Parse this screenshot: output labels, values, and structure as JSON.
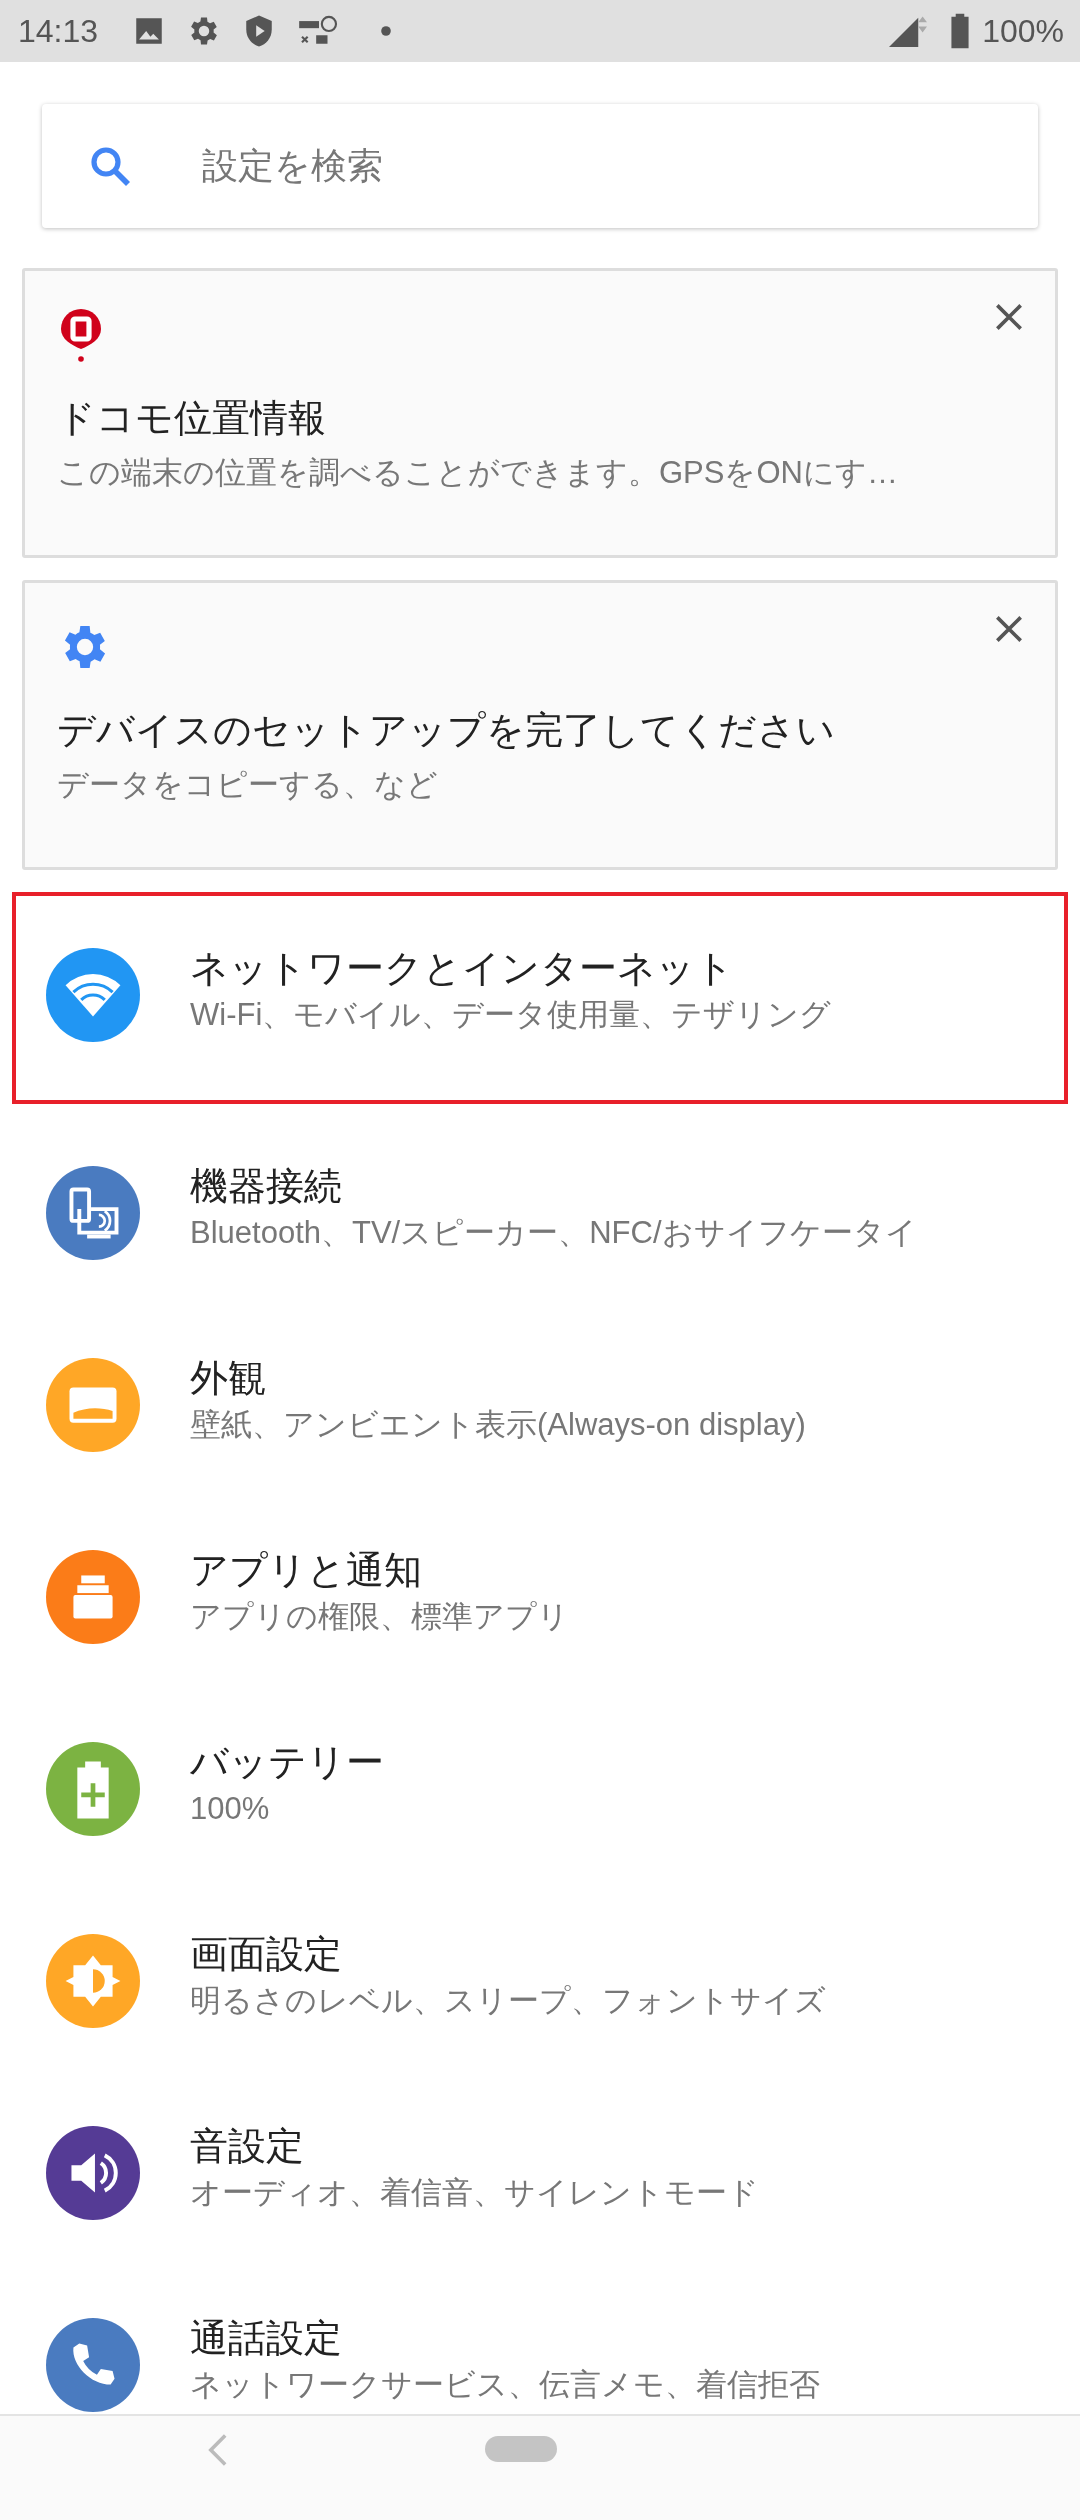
{
  "status_bar": {
    "time": "14:13",
    "battery": "100%"
  },
  "search": {
    "placeholder": "設定を検索"
  },
  "suggestions": [
    {
      "kind": "location",
      "title": "ドコモ位置情報",
      "summary": "この端末の位置を調べることができます。GPSをONにす…"
    },
    {
      "kind": "setup",
      "title": "デバイスのセットアップを完了してください",
      "summary": "データをコピーする、など"
    }
  ],
  "items": [
    {
      "kind": "wifi",
      "color": "#2196f3",
      "title": "ネットワークとインターネット",
      "summary": "Wi-Fi、モバイル、データ使用量、テザリング",
      "highlighted": true
    },
    {
      "kind": "devices",
      "color": "#4a7bc0",
      "title": "機器接続",
      "summary": "Bluetooth、TV/スピーカー、NFC/おサイフケータイ",
      "highlighted": false
    },
    {
      "kind": "display",
      "color": "#ffa726",
      "title": "外観",
      "summary": "壁紙、アンビエント表示(Always-on display)",
      "highlighted": false
    },
    {
      "kind": "apps",
      "color": "#fb7c18",
      "title": "アプリと通知",
      "summary": "アプリの権限、標準アプリ",
      "highlighted": false
    },
    {
      "kind": "battery",
      "color": "#7cb342",
      "title": "バッテリー",
      "summary": "100%",
      "highlighted": false
    },
    {
      "kind": "brightness",
      "color": "#ffa726",
      "title": "画面設定",
      "summary": "明るさのレベル、スリープ、フォントサイズ",
      "highlighted": false
    },
    {
      "kind": "sound",
      "color": "#553b95",
      "title": "音設定",
      "summary": "オーディオ、着信音、サイレントモード",
      "highlighted": false
    },
    {
      "kind": "phone",
      "color": "#4a7bc0",
      "title": "通話設定",
      "summary": "ネットワークサービス、伝言メモ、着信拒否",
      "highlighted": false
    }
  ]
}
